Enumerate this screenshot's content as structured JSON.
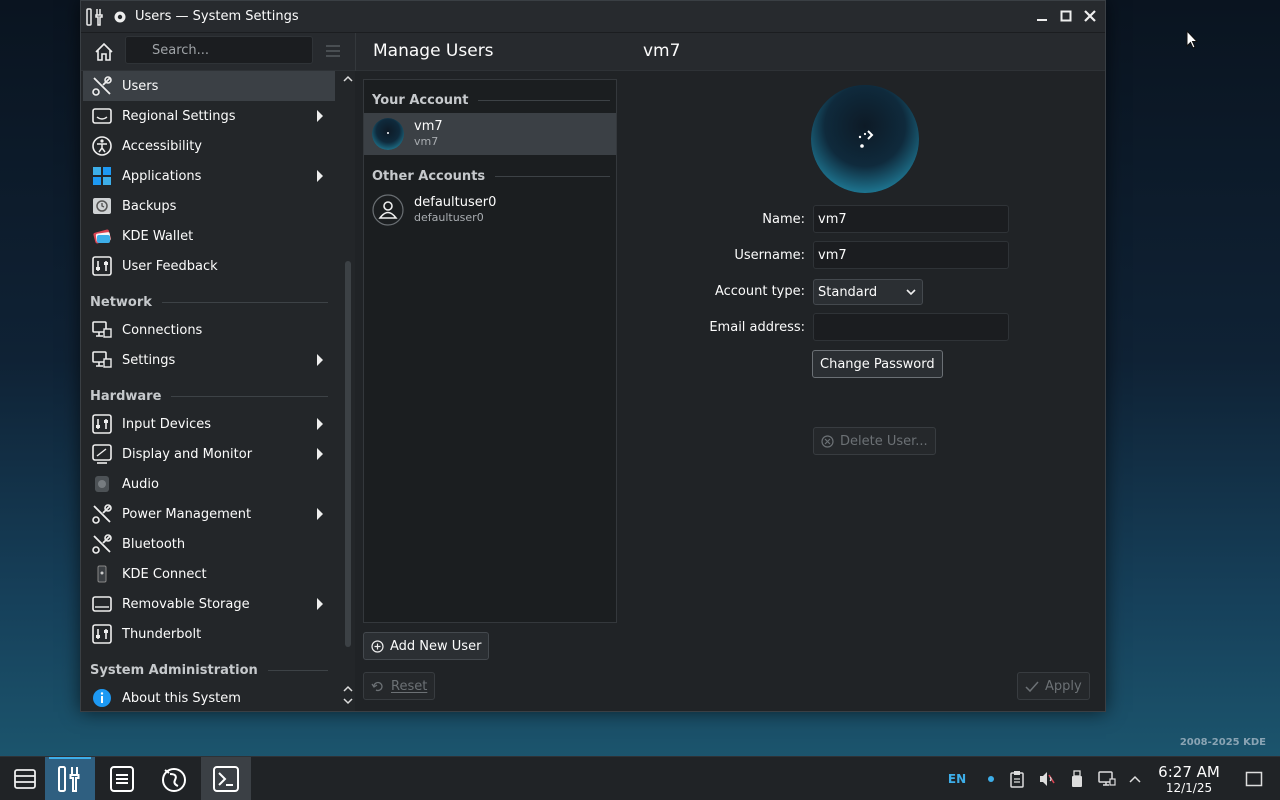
{
  "window": {
    "title": "Users — System Settings"
  },
  "header": {
    "search_placeholder": "Search...",
    "page_title": "Manage Users",
    "user_heading": "vm7"
  },
  "sidebar": {
    "items": [
      {
        "label": "Users",
        "icon": "users-icon",
        "chevron": false,
        "active": true
      },
      {
        "label": "Regional Settings",
        "icon": "regional-settings-icon",
        "chevron": true
      },
      {
        "label": "Accessibility",
        "icon": "accessibility-icon",
        "chevron": false
      },
      {
        "label": "Applications",
        "icon": "applications-icon",
        "chevron": true
      },
      {
        "label": "Backups",
        "icon": "backups-icon",
        "chevron": false
      },
      {
        "label": "KDE Wallet",
        "icon": "kde-wallet-icon",
        "chevron": false
      },
      {
        "label": "User Feedback",
        "icon": "user-feedback-icon",
        "chevron": false
      }
    ],
    "network_heading": "Network",
    "network_items": [
      {
        "label": "Connections",
        "icon": "connections-icon",
        "chevron": false
      },
      {
        "label": "Settings",
        "icon": "network-settings-icon",
        "chevron": true
      }
    ],
    "hardware_heading": "Hardware",
    "hardware_items": [
      {
        "label": "Input Devices",
        "icon": "input-devices-icon",
        "chevron": true
      },
      {
        "label": "Display and Monitor",
        "icon": "display-icon",
        "chevron": true
      },
      {
        "label": "Audio",
        "icon": "audio-icon",
        "chevron": false
      },
      {
        "label": "Power Management",
        "icon": "power-management-icon",
        "chevron": true
      },
      {
        "label": "Bluetooth",
        "icon": "bluetooth-icon",
        "chevron": false
      },
      {
        "label": "KDE Connect",
        "icon": "kde-connect-icon",
        "chevron": false
      },
      {
        "label": "Removable Storage",
        "icon": "removable-storage-icon",
        "chevron": true
      },
      {
        "label": "Thunderbolt",
        "icon": "thunderbolt-icon",
        "chevron": false
      }
    ],
    "sysadmin_heading": "System Administration",
    "sysadmin_items": [
      {
        "label": "About this System",
        "icon": "info-icon",
        "chevron": false
      }
    ]
  },
  "accounts": {
    "your_account_heading": "Your Account",
    "your_account": {
      "name": "vm7",
      "username": "vm7"
    },
    "other_accounts_heading": "Other Accounts",
    "other_accounts": [
      {
        "name": "defaultuser0",
        "username": "defaultuser0"
      }
    ],
    "add_new_user_label": "Add New User"
  },
  "details": {
    "name_label": "Name:",
    "name_value": "vm7",
    "username_label": "Username:",
    "username_value": "vm7",
    "account_type_label": "Account type:",
    "account_type_value": "Standard",
    "email_label": "Email address:",
    "email_value": "",
    "change_password_label": "Change Password",
    "delete_user_label": "Delete User..."
  },
  "footer": {
    "reset_label": "Reset",
    "apply_label": "Apply"
  },
  "desktop": {
    "watermark": "2008-2025 KDE"
  },
  "taskbar": {
    "lang": "EN",
    "time": "6:27 AM",
    "date": "12/1/25"
  },
  "colors": {
    "accent": "#3daee9",
    "window_bg": "#202326",
    "selection": "#3b4045"
  }
}
